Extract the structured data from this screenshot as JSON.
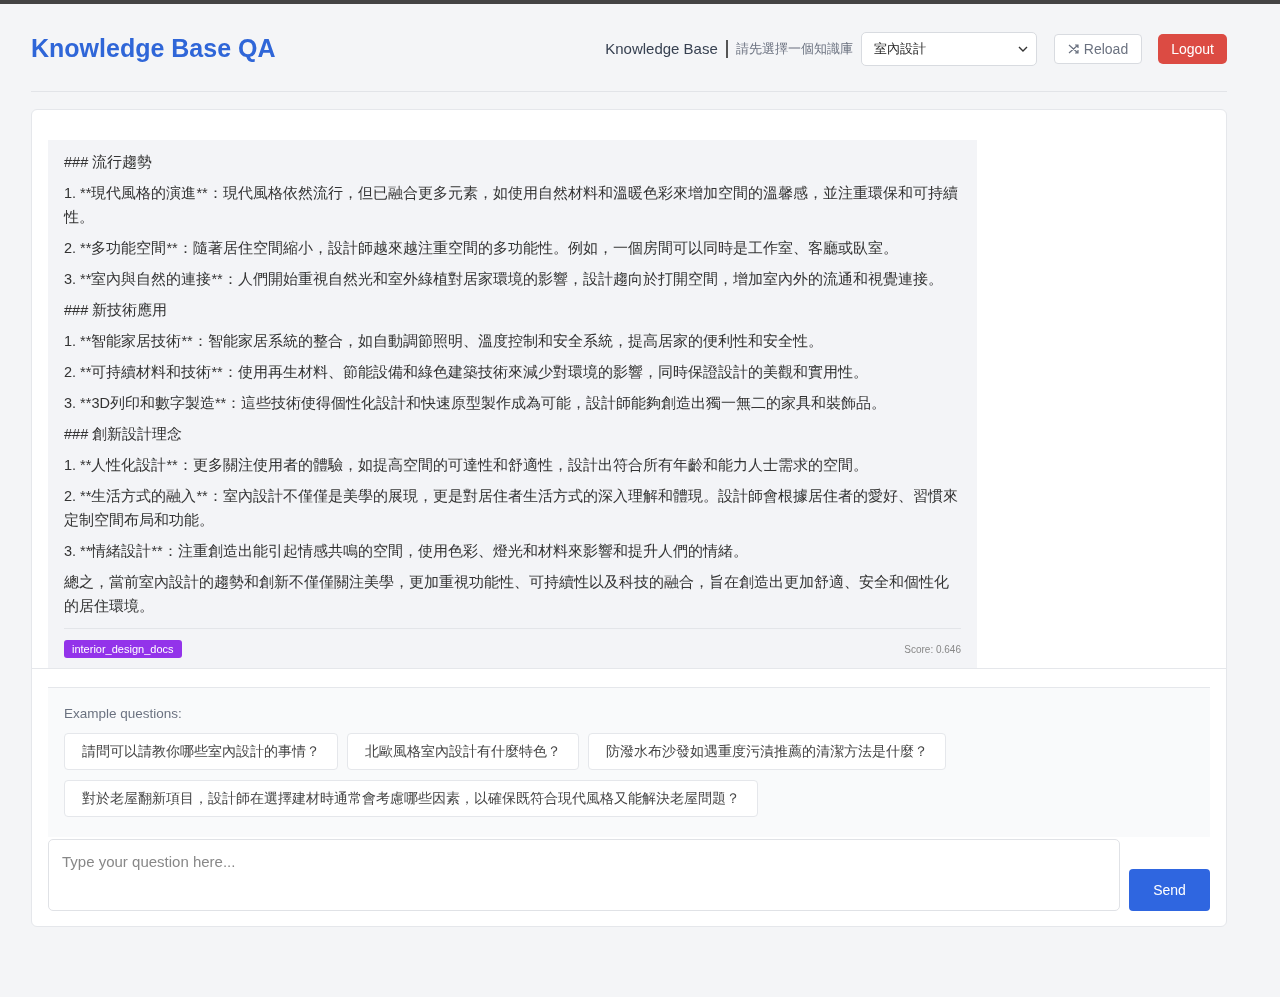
{
  "header": {
    "title": "Knowledge Base QA",
    "kb_label": "Knowledge Base",
    "kb_hint": "請先選擇一個知識庫",
    "kb_select": {
      "value": "室內設計"
    },
    "reload_button": "Reload",
    "logout_button": "Logout"
  },
  "message": {
    "paragraphs": [
      "### 流行趨勢",
      "1. **現代風格的演進**：現代風格依然流行，但已融合更多元素，如使用自然材料和溫暖色彩來增加空間的溫馨感，並注重環保和可持續性。",
      "2. **多功能空間**：隨著居住空間縮小，設計師越來越注重空間的多功能性。例如，一個房間可以同時是工作室、客廳或臥室。",
      "3. **室內與自然的連接**：人們開始重視自然光和室外綠植對居家環境的影響，設計趨向於打開空間，增加室內外的流通和視覺連接。",
      "### 新技術應用",
      "1. **智能家居技術**：智能家居系統的整合，如自動調節照明、溫度控制和安全系統，提高居家的便利性和安全性。",
      "2. **可持續材料和技術**：使用再生材料、節能設備和綠色建築技術來減少對環境的影響，同時保證設計的美觀和實用性。",
      "3. **3D列印和數字製造**：這些技術使得個性化設計和快速原型製作成為可能，設計師能夠創造出獨一無二的家具和裝飾品。",
      "### 創新設計理念",
      "1. **人性化設計**：更多關注使用者的體驗，如提高空間的可達性和舒適性，設計出符合所有年齡和能力人士需求的空間。",
      "2. **生活方式的融入**：室內設計不僅僅是美學的展現，更是對居住者生活方式的深入理解和體現。設計師會根據居住者的愛好、習慣來定制空間布局和功能。",
      "3. **情緒設計**：注重創造出能引起情感共鳴的空間，使用色彩、燈光和材料來影響和提升人們的情緒。",
      "總之，當前室內設計的趨勢和創新不僅僅關注美學，更加重視功能性、可持續性以及科技的融合，旨在創造出更加舒適、安全和個性化的居住環境。"
    ],
    "source_tag": "interior_design_docs",
    "score": "Score: 0.646"
  },
  "examples": {
    "label": "Example questions:",
    "questions": [
      "請問可以請教你哪些室內設計的事情？",
      "北歐風格室內設計有什麼特色？",
      "防潑水布沙發如遇重度污漬推薦的清潔方法是什麼？",
      "對於老屋翻新項目，設計師在選擇建材時通常會考慮哪些因素，以確保既符合現代風格又能解決老屋問題？"
    ]
  },
  "input": {
    "placeholder": "Type your question here..."
  },
  "send_button": "Send"
}
